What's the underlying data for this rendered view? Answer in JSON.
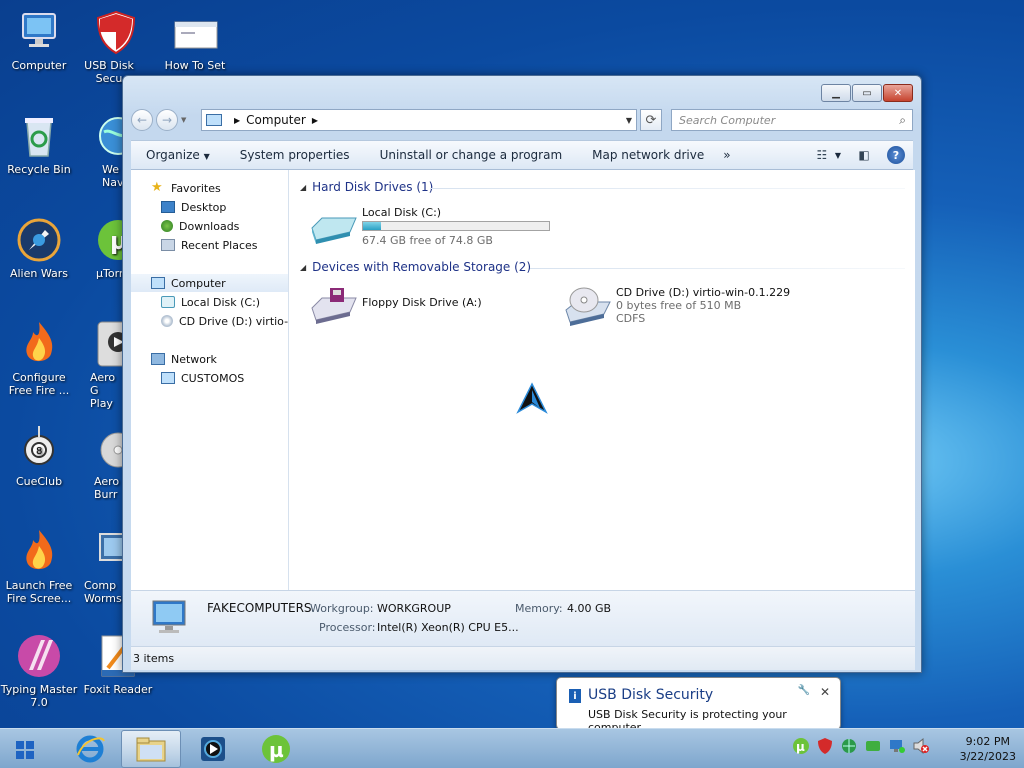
{
  "desktop": {
    "icons": [
      {
        "label": "Computer"
      },
      {
        "label": "USB Disk Secu"
      },
      {
        "label": "How To Set"
      },
      {
        "label": "Recycle Bin"
      },
      {
        "label": "We Naviga"
      },
      {
        "label": "Alien Wars"
      },
      {
        "label": "µTorr"
      },
      {
        "label": "Configure Free Fire ..."
      },
      {
        "label": "Aero G Play"
      },
      {
        "label": "CueClub"
      },
      {
        "label": "Aero Burr"
      },
      {
        "label": "Launch Free Fire Scree..."
      },
      {
        "label": "Comp Worms"
      },
      {
        "label": "Typing Master 7.0"
      },
      {
        "label": "Foxit Reader"
      }
    ]
  },
  "window": {
    "address_crumb": "Computer",
    "search_placeholder": "Search Computer",
    "toolbar": {
      "organize": "Organize",
      "system_properties": "System properties",
      "uninstall": "Uninstall or change a program",
      "map_drive": "Map network drive",
      "more": "»"
    },
    "nav": {
      "favorites": "Favorites",
      "desktop": "Desktop",
      "downloads": "Downloads",
      "recent": "Recent Places",
      "computer": "Computer",
      "local_disk": "Local Disk (C:)",
      "cd_drive": "CD Drive (D:) virtio-w",
      "network": "Network",
      "customos": "CUSTOMOS"
    },
    "groups": {
      "hdd": "Hard Disk Drives (1)",
      "removable": "Devices with Removable Storage (2)"
    },
    "drives": {
      "c_name": "Local Disk (C:)",
      "c_free": "67.4 GB free of 74.8 GB",
      "c_used_fraction": 0.099,
      "floppy_name": "Floppy Disk Drive (A:)",
      "cd_name": "CD Drive (D:) virtio-win-0.1.229",
      "cd_free": "0 bytes free of 510 MB",
      "cd_fs": "CDFS"
    },
    "details": {
      "computer_name": "FAKECOMPUTERS",
      "workgroup_label": "Workgroup:",
      "workgroup": "WORKGROUP",
      "memory_label": "Memory:",
      "memory": "4.00 GB",
      "processor_label": "Processor:",
      "processor": "Intel(R) Xeon(R) CPU E5..."
    },
    "status": "3 items"
  },
  "notification": {
    "title": "USB Disk Security",
    "body": "USB Disk Security is protecting your computer"
  },
  "taskbar": {
    "time": "9:02 PM",
    "date": "3/22/2023"
  }
}
